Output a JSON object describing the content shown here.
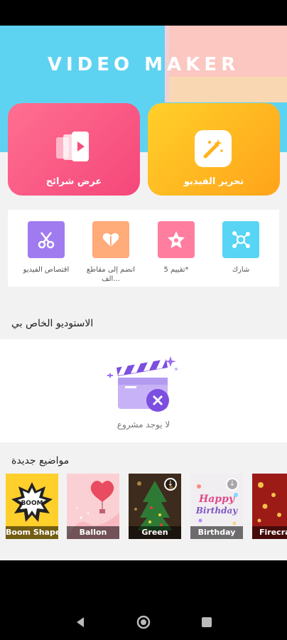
{
  "app": {
    "title": "VIDEO MAKER"
  },
  "cards": {
    "slideshow_label": "عرض شرائح",
    "edit_video_label": "تحرير الفيديو"
  },
  "tools": [
    {
      "label": "اقتصاص الفيديو",
      "icon": "scissors-icon",
      "color": "#a07bf0"
    },
    {
      "label": "انضم إلى مقاطع الف...",
      "icon": "heart-merge-icon",
      "color": "#ffab7a"
    },
    {
      "label": "تقييم 5*",
      "icon": "star-icon",
      "color": "#ff7ea0"
    },
    {
      "label": "شارك",
      "icon": "share-icon",
      "color": "#58d4f5"
    }
  ],
  "studio": {
    "title": "الاستوديو الخاص بي",
    "empty_text": "لا يوجد مشروع"
  },
  "topics": {
    "title": "مواضيع جديدة",
    "items": [
      {
        "label": "Boom Shape"
      },
      {
        "label": "Ballon"
      },
      {
        "label": "Green"
      },
      {
        "label": "Birthday"
      },
      {
        "label": "Firecra"
      }
    ]
  }
}
